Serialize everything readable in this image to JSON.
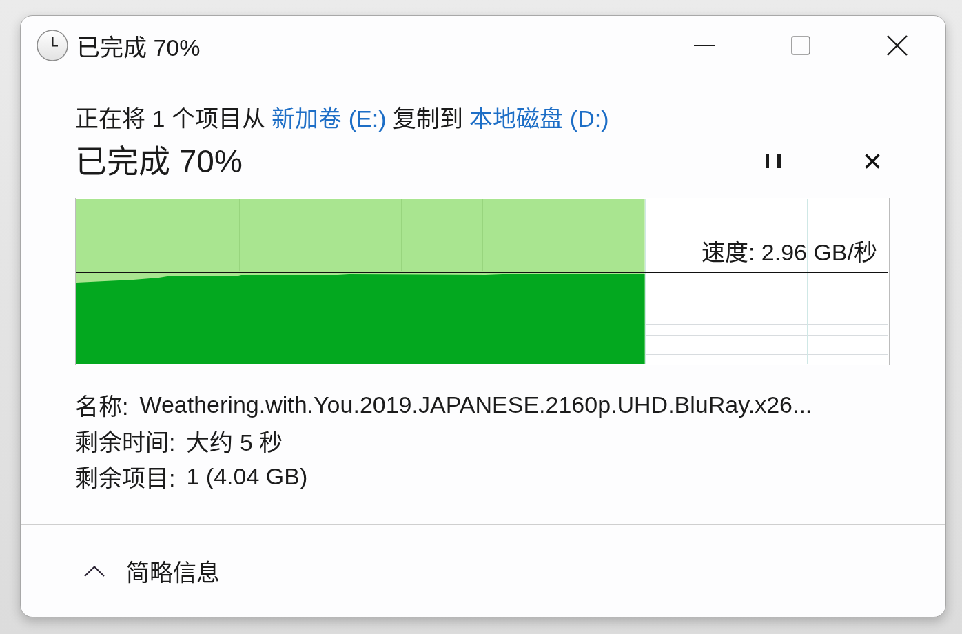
{
  "window": {
    "title": "已完成 70%"
  },
  "copy_status": {
    "description": [
      {
        "kind": "text",
        "text": "正在将 1 个项目从"
      },
      {
        "kind": "link",
        "text": "新加卷 (E:)"
      },
      {
        "kind": "text",
        "text": "复制到"
      },
      {
        "kind": "link",
        "text": "本地磁盘 (D:)"
      }
    ],
    "heading": "已完成 70%",
    "progress": {
      "level": 0.7,
      "speed": "速度: 2.96 GB/秒"
    },
    "details": [
      {
        "label": "名称:",
        "value": "Weathering.with.You.2019.JAPANESE.2160p.UHD.BluRay.x26..."
      },
      {
        "label": "剩余时间:",
        "value": "大约 5 秒"
      },
      {
        "label": "剩余项目:",
        "value": "1 (4.04 GB)"
      }
    ]
  },
  "footer": {
    "toggle": {
      "label": "简略信息",
      "expanded": true
    }
  }
}
